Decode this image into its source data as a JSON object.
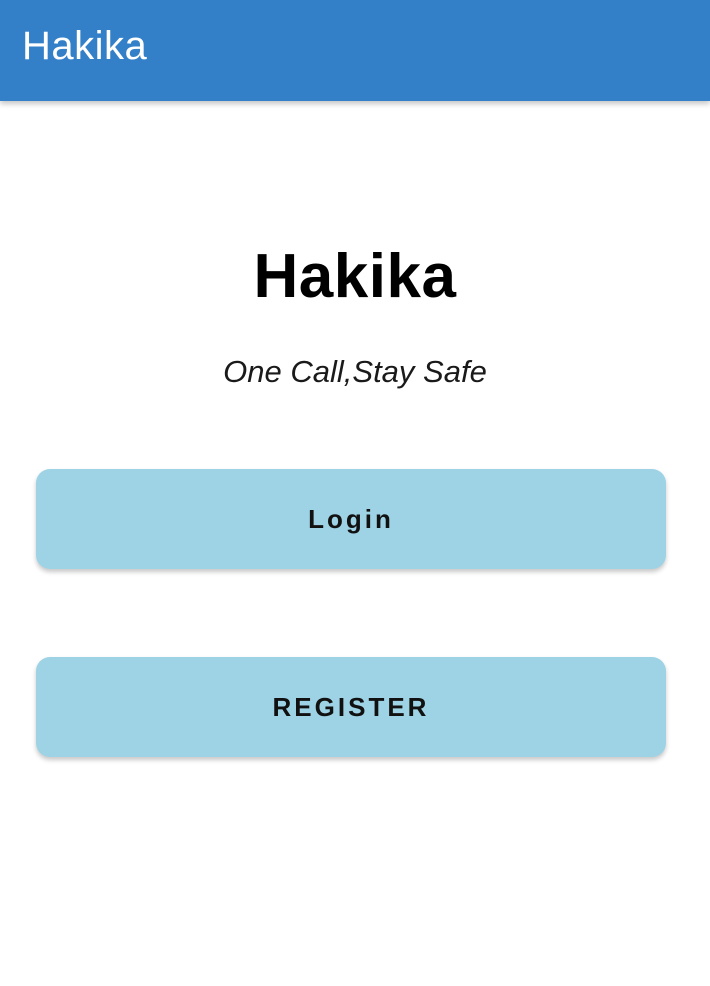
{
  "app_bar": {
    "title": "Hakika",
    "background_color": "#3380c8"
  },
  "main": {
    "headline": "Hakika",
    "tagline": "One Call,Stay Safe"
  },
  "buttons": {
    "login_label": "Login",
    "register_label": "REGISTER",
    "background_color": "#9dd3e5"
  }
}
